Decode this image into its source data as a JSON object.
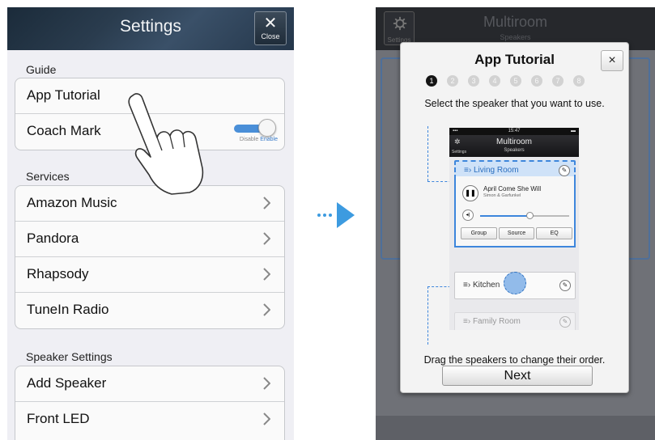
{
  "settings": {
    "title": "Settings",
    "close_label": "Close",
    "sections": [
      {
        "label": "Guide",
        "items": [
          {
            "label": "App Tutorial"
          },
          {
            "label": "Coach Mark",
            "toggle": {
              "off_label": "Disable",
              "on_label": "Enable",
              "state": "on"
            }
          }
        ]
      },
      {
        "label": "Services",
        "items": [
          {
            "label": "Amazon Music"
          },
          {
            "label": "Pandora"
          },
          {
            "label": "Rhapsody"
          },
          {
            "label": "TuneIn Radio"
          }
        ]
      },
      {
        "label": "Speaker Settings",
        "items": [
          {
            "label": "Add Speaker"
          },
          {
            "label": "Front LED"
          }
        ]
      }
    ]
  },
  "multiroom": {
    "title": "Multiroom",
    "subtitle": "Speakers",
    "settings_label": "Settings"
  },
  "tutorial": {
    "title": "App Tutorial",
    "close_glyph": "×",
    "steps": [
      "1",
      "2",
      "3",
      "4",
      "5",
      "6",
      "7",
      "8"
    ],
    "current_step": 1,
    "instruction": "Select the speaker that you want to use.",
    "footer": "Drag the speakers to change their order.",
    "next_label": "Next",
    "mini": {
      "time": "15:47",
      "title": "Multiroom",
      "subtitle": "Speakers",
      "settings_label": "Settings",
      "rooms": [
        {
          "name": "Living Room",
          "selected": true
        },
        {
          "name": "Kitchen",
          "selected": false
        },
        {
          "name": "Family Room",
          "selected": false
        }
      ],
      "song": "April Come She Will",
      "artist": "Simon & Garfunkel",
      "volume": 0.55,
      "buttons": [
        "Group",
        "Source",
        "EQ"
      ]
    }
  },
  "icons": {
    "chevron": "chevron-right-icon",
    "close": "close-icon",
    "gear": "gear-icon",
    "hand": "pointing-hand-icon",
    "arrow": "right-arrow-icon"
  },
  "colors": {
    "accent_blue": "#3d86dc",
    "toggle_blue": "#4a8fd8",
    "nav_dark": "#1b2b3a"
  }
}
